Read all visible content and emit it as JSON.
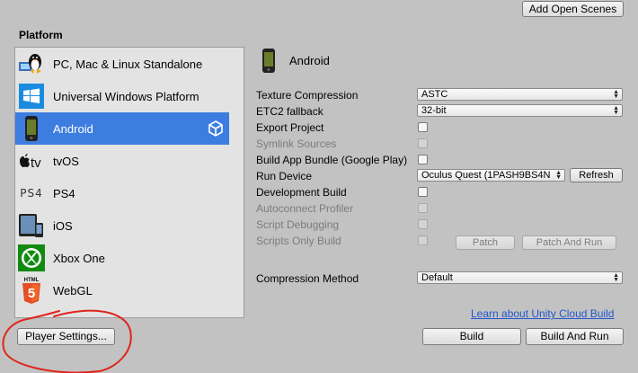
{
  "header": {
    "add_open_scenes_label": "Add Open Scenes"
  },
  "platform": {
    "heading": "Platform",
    "items": [
      {
        "label": "PC, Mac & Linux Standalone",
        "icon": "pc-mac-linux-icon"
      },
      {
        "label": "Universal Windows Platform",
        "icon": "windows-icon"
      },
      {
        "label": "Android",
        "icon": "android-phone-icon",
        "selected": true
      },
      {
        "label": "tvOS",
        "icon": "apple-tv-icon"
      },
      {
        "label": "PS4",
        "icon": "ps4-icon"
      },
      {
        "label": "iOS",
        "icon": "ios-devices-icon"
      },
      {
        "label": "Xbox One",
        "icon": "xbox-icon"
      },
      {
        "label": "WebGL",
        "icon": "html5-icon"
      }
    ],
    "ps4_logo_text": "PS4",
    "tv_logo_text": "tv",
    "html_logo_text": "HTML",
    "html_logo_number": "5"
  },
  "settings": {
    "title": "Android",
    "texture_compression": {
      "label": "Texture Compression",
      "value": "ASTC"
    },
    "etc2_fallback": {
      "label": "ETC2 fallback",
      "value": "32-bit"
    },
    "export_project": {
      "label": "Export Project"
    },
    "symlink_sources": {
      "label": "Symlink Sources"
    },
    "build_app_bundle": {
      "label": "Build App Bundle (Google Play)"
    },
    "run_device": {
      "label": "Run Device",
      "value": "Oculus Quest (1PASH9BS4N",
      "refresh_label": "Refresh"
    },
    "development_build": {
      "label": "Development Build"
    },
    "autoconnect_profiler": {
      "label": "Autoconnect Profiler"
    },
    "script_debugging": {
      "label": "Script Debugging"
    },
    "scripts_only_build": {
      "label": "Scripts Only Build"
    },
    "patch_label": "Patch",
    "patch_and_run_label": "Patch And Run",
    "compression_method": {
      "label": "Compression Method",
      "value": "Default"
    }
  },
  "footer": {
    "cloud_link": "Learn about Unity Cloud Build",
    "player_settings_label": "Player Settings...",
    "build_label": "Build",
    "build_and_run_label": "Build And Run"
  },
  "colors": {
    "selection": "#3e7de0",
    "link": "#2255cc",
    "annotation": "#e0251b"
  }
}
